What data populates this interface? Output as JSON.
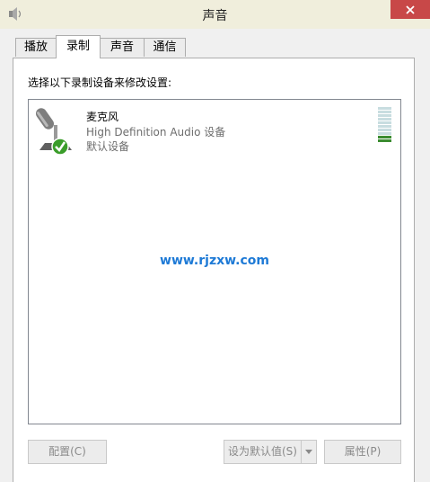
{
  "window": {
    "title": "声音"
  },
  "tabs": [
    {
      "label": "播放",
      "active": false
    },
    {
      "label": "录制",
      "active": true
    },
    {
      "label": "声音",
      "active": false
    },
    {
      "label": "通信",
      "active": false
    }
  ],
  "content": {
    "instruction": "选择以下录制设备来修改设置:",
    "devices": [
      {
        "name": "麦克风",
        "description": "High Definition Audio 设备",
        "status": "默认设备",
        "icon": "microphone-icon",
        "default_badge": "green-check-icon",
        "level_bars_total": 10,
        "level_bars_active": 2
      }
    ],
    "watermark": "www.rjzxw.com"
  },
  "buttons": {
    "configure": "配置(C)",
    "set_default": "设为默认值(S)",
    "properties": "属性(P)"
  },
  "colors": {
    "close_button": "#c84848",
    "level_active": "#3b8c30",
    "watermark": "#1e7ad6"
  }
}
